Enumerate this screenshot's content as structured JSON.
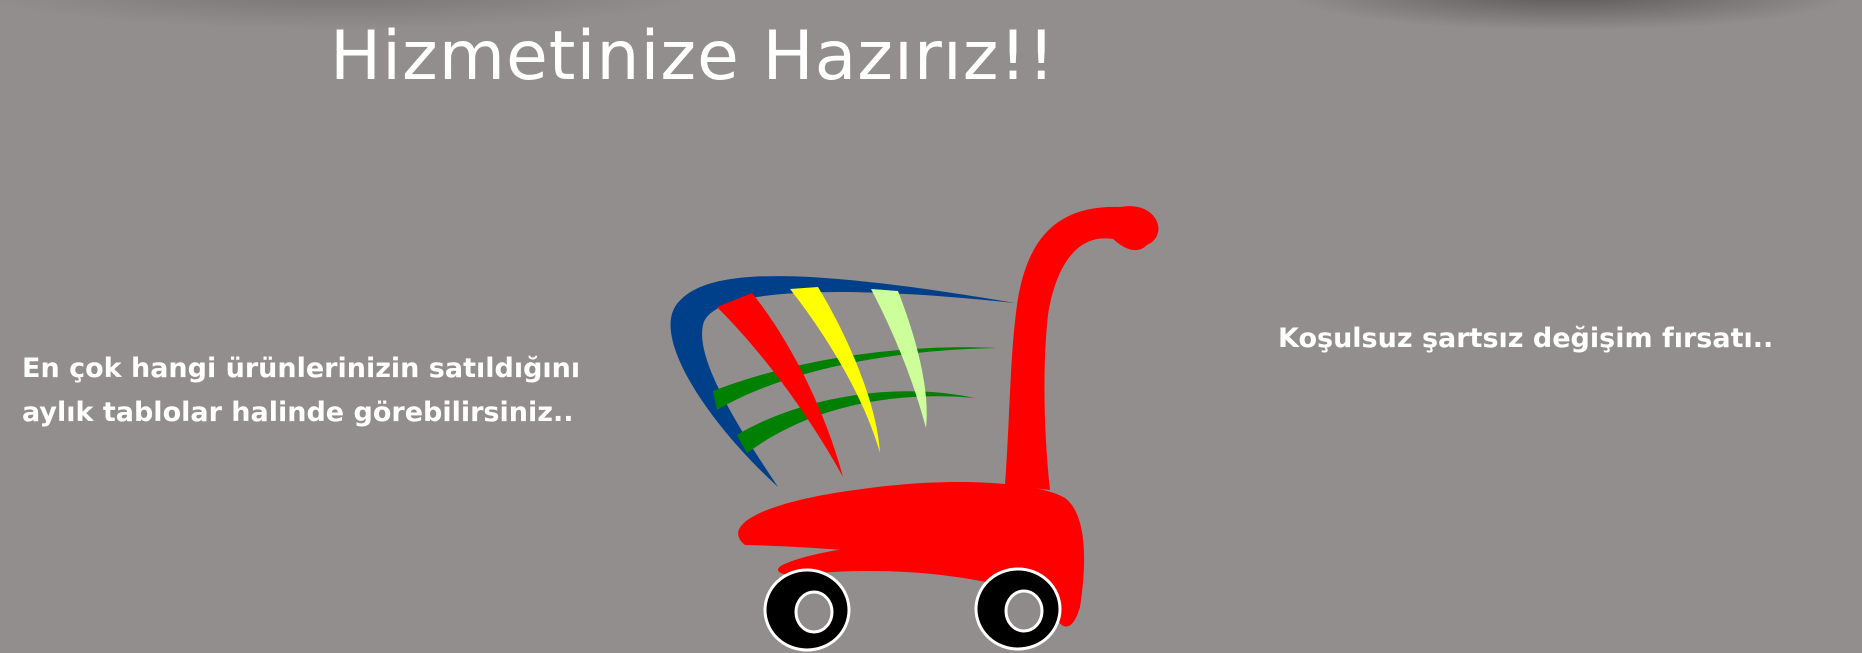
{
  "header": {
    "title": "Hizmetinize Hazırız!!"
  },
  "features": {
    "reports_line1": "En çok hangi ürünlerinizin satıldığını",
    "reports_line2": "aylık tablolar halinde görebilirsiniz..",
    "exchange": "Koşulsuz şartsız değişim fırsatı.."
  },
  "illustration": {
    "icon": "shopping-cart-icon",
    "colors": {
      "background": "#918e8d",
      "cart_body": "#ff0000",
      "blue_swoosh": "#003f8a",
      "green_stripes": "#008000",
      "yellow_stripe": "#ffff00",
      "light_green_stripe": "#ccff99",
      "red_stripe": "#ff0000",
      "wheels": "#000000"
    }
  }
}
